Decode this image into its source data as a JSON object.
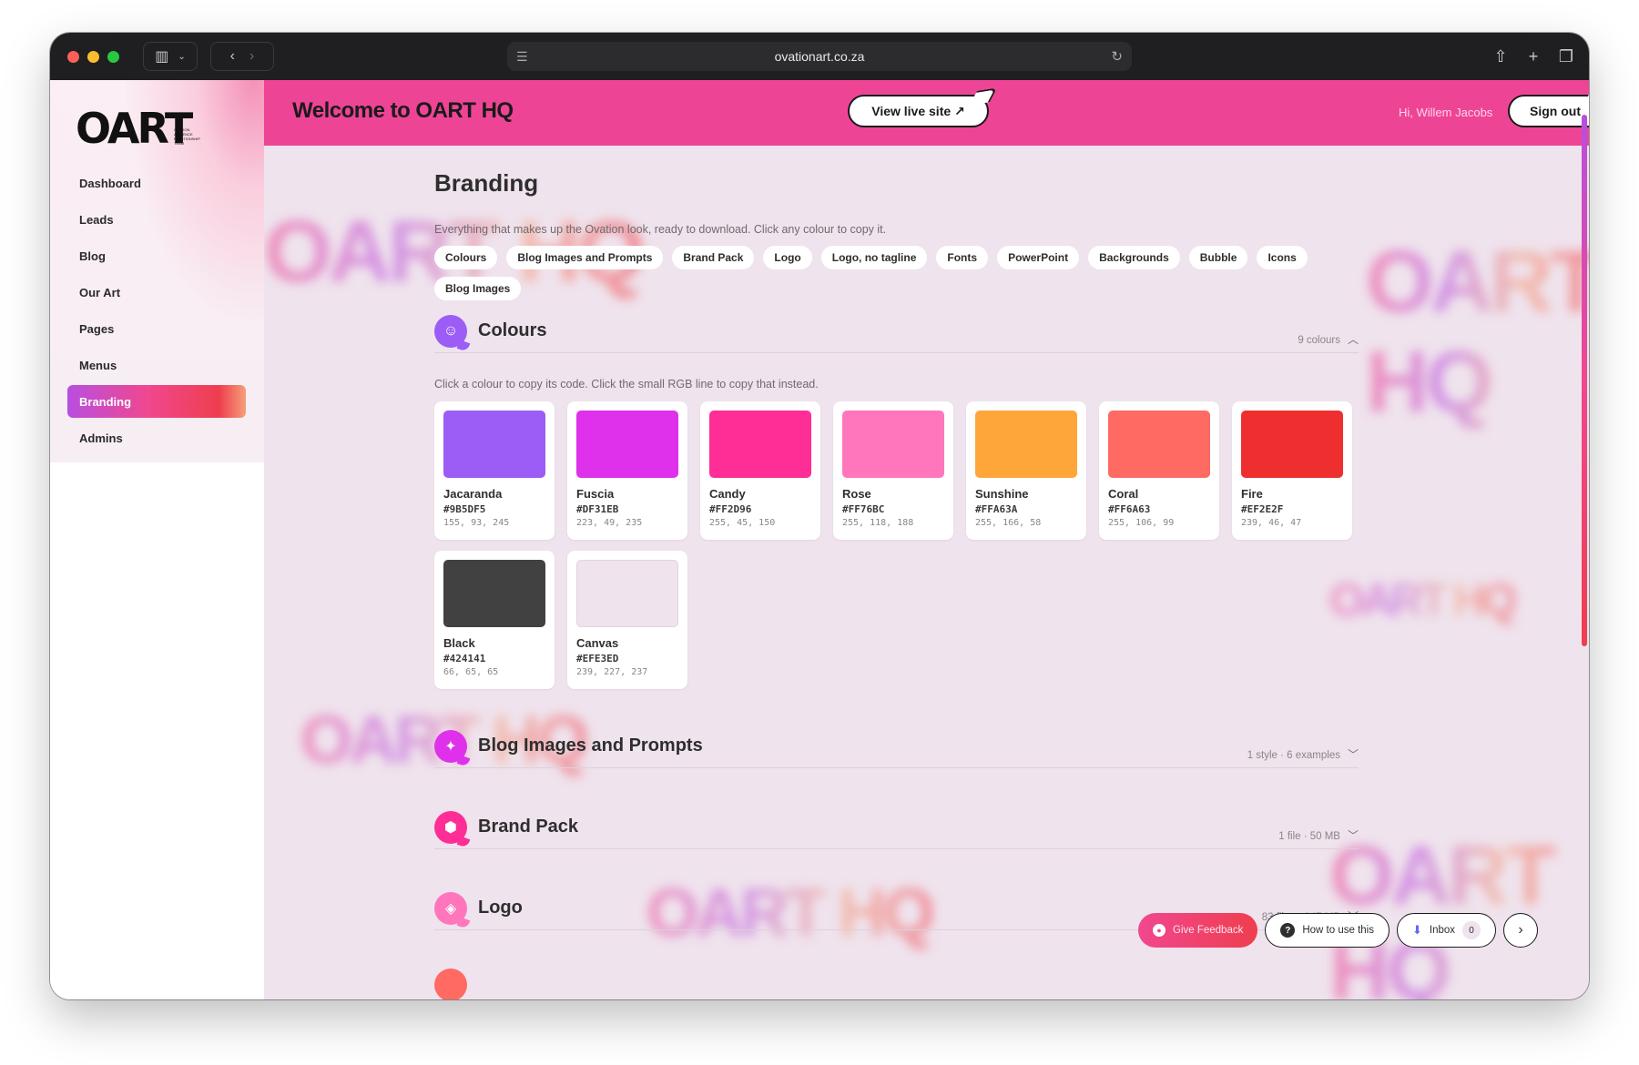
{
  "browser": {
    "url": "ovationart.co.za"
  },
  "sidebar": {
    "logo": "OART",
    "logo_tagline": "OVATION AUDIENCE RELATIONSHIP TEAM",
    "items": [
      {
        "label": "Dashboard",
        "active": false
      },
      {
        "label": "Leads",
        "active": false
      },
      {
        "label": "Blog",
        "active": false
      },
      {
        "label": "Our Art",
        "active": false
      },
      {
        "label": "Pages",
        "active": false
      },
      {
        "label": "Menus",
        "active": false
      },
      {
        "label": "Branding",
        "active": true
      },
      {
        "label": "Admins",
        "active": false
      }
    ]
  },
  "header": {
    "title": "Welcome to OART HQ",
    "view_live": "View live site ↗",
    "greeting": "Hi, Willem Jacobs",
    "sign_out": "Sign out"
  },
  "page": {
    "title": "Branding",
    "subtitle": "Everything that makes up the Ovation look, ready to download. Click any colour to copy it.",
    "chips": [
      "Colours",
      "Blog Images and Prompts",
      "Brand Pack",
      "Logo",
      "Logo, no tagline",
      "Fonts",
      "PowerPoint",
      "Backgrounds",
      "Bubble",
      "Icons",
      "Blog Images"
    ]
  },
  "sections": {
    "colours": {
      "title": "Colours",
      "meta": "9 colours",
      "icon": "palette-icon",
      "color": "#9B5DF5"
    },
    "blog_images": {
      "title": "Blog Images and Prompts",
      "meta": "1 style · 6 examples",
      "icon": "sparkle-icon",
      "color": "#DF31EB"
    },
    "brand_pack": {
      "title": "Brand Pack",
      "meta": "1 file · 50 MB",
      "icon": "box-icon",
      "color": "#FF2D96"
    },
    "logo": {
      "title": "Logo",
      "meta": "83 files · 147 MB",
      "icon": "tag-icon",
      "color": "#FF76BC"
    }
  },
  "colours_hint": "Click a colour to copy its code. Click the small RGB line to copy that instead.",
  "swatches": [
    {
      "name": "Jacaranda",
      "hex": "#9B5DF5",
      "rgb": "155, 93, 245"
    },
    {
      "name": "Fuscia",
      "hex": "#DF31EB",
      "rgb": "223, 49, 235"
    },
    {
      "name": "Candy",
      "hex": "#FF2D96",
      "rgb": "255, 45, 150"
    },
    {
      "name": "Rose",
      "hex": "#FF76BC",
      "rgb": "255, 118, 188"
    },
    {
      "name": "Sunshine",
      "hex": "#FFA63A",
      "rgb": "255, 166, 58"
    },
    {
      "name": "Coral",
      "hex": "#FF6A63",
      "rgb": "255, 106, 99"
    },
    {
      "name": "Fire",
      "hex": "#EF2E2F",
      "rgb": "239, 46, 47"
    },
    {
      "name": "Black",
      "hex": "#424141",
      "rgb": "66, 65, 65"
    },
    {
      "name": "Canvas",
      "hex": "#EFE3ED",
      "rgb": "239, 227, 237"
    }
  ],
  "float_bar": {
    "feedback": "Give Feedback",
    "how_to": "How to use this",
    "inbox": "Inbox",
    "inbox_count": "0"
  },
  "watermark": "OART HQ"
}
